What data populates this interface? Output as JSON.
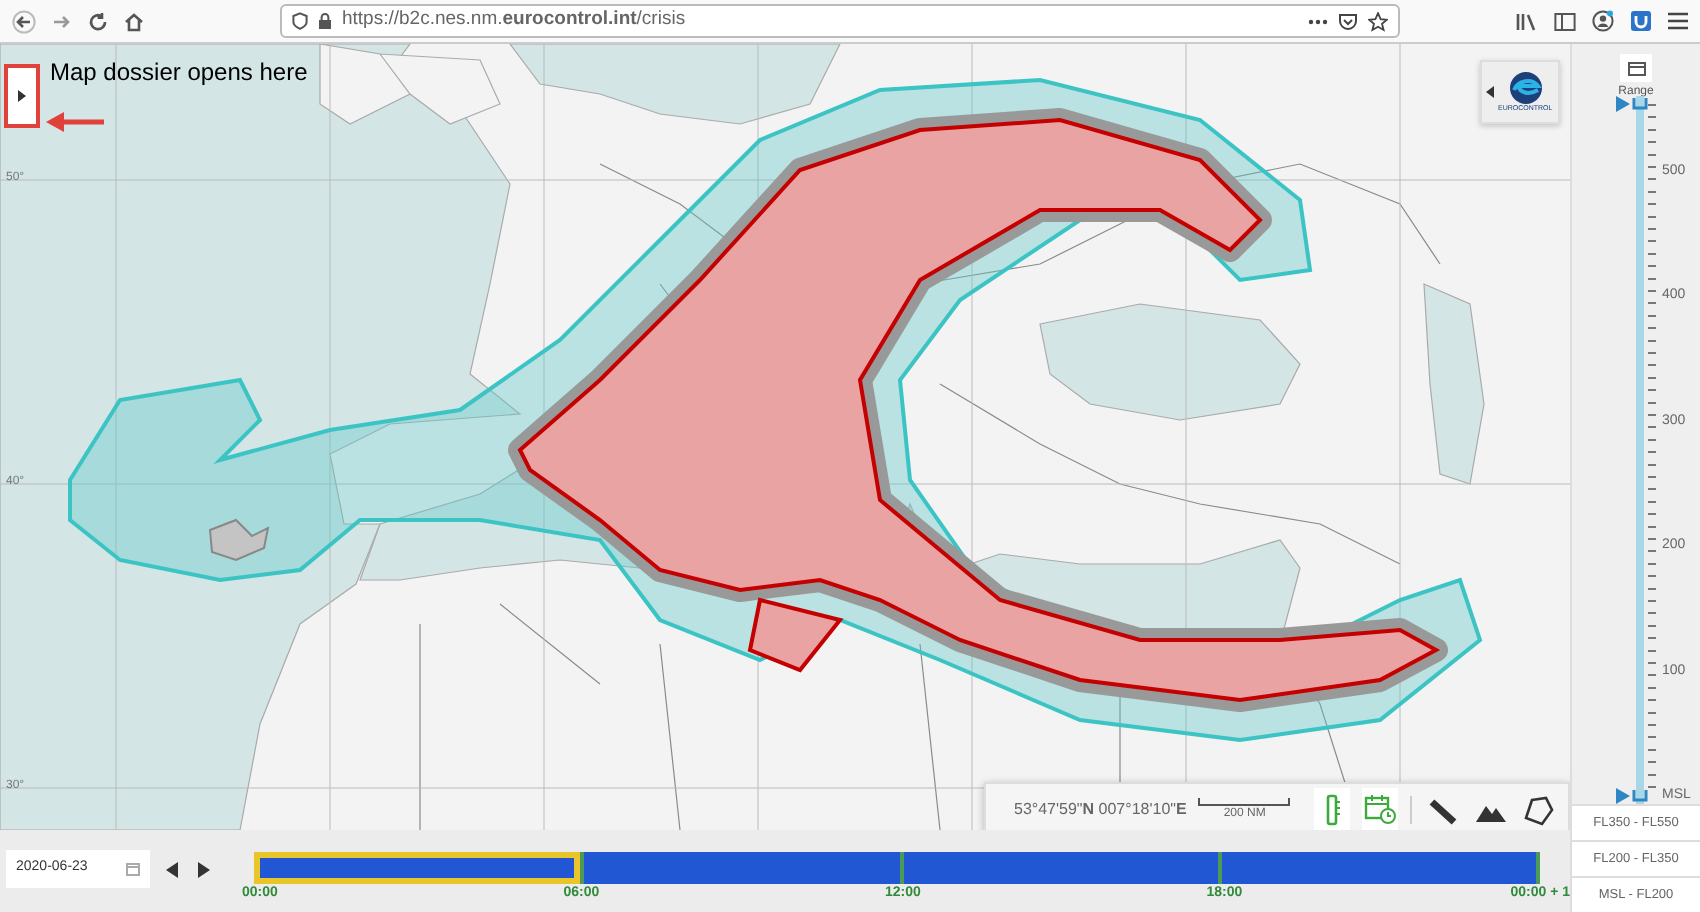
{
  "browser": {
    "url": "https://b2c.nes.nm.**eurocontrol.int**/crisis"
  },
  "annotation": {
    "text": "Map dossier opens here"
  },
  "map": {
    "latitude_labels": [
      "50°",
      "40°",
      "30°"
    ]
  },
  "logo": {
    "text": "EUROCONTROL"
  },
  "status": {
    "coordinates": "53°47'59\"**N** 007°18'10\"**E**",
    "scale": "200 NM"
  },
  "map_tools": [
    {
      "kind": "altitude",
      "active": true
    },
    {
      "kind": "schedule",
      "active": true
    },
    {
      "kind": "ruler",
      "active": false
    },
    {
      "kind": "terrain",
      "active": false
    },
    {
      "kind": "polygon",
      "active": false
    }
  ],
  "range": {
    "label": "Range",
    "ticks": [
      "500",
      "400",
      "300",
      "200",
      "100",
      "MSL"
    ],
    "thumbs": [
      {
        "level": 1
      },
      {
        "level": 0
      }
    ]
  },
  "level_buttons": [
    "FL350 - FL550",
    "FL200 - FL350",
    "MSL - FL200"
  ],
  "timeline": {
    "date": "2020-06-23",
    "segments": [
      {
        "label": "00:00",
        "selected": true
      },
      {
        "label": "06:00",
        "selected": false
      },
      {
        "label": "12:00",
        "selected": false
      },
      {
        "label": "18:00",
        "selected": false
      }
    ],
    "end_label": "00:00 + 1"
  }
}
